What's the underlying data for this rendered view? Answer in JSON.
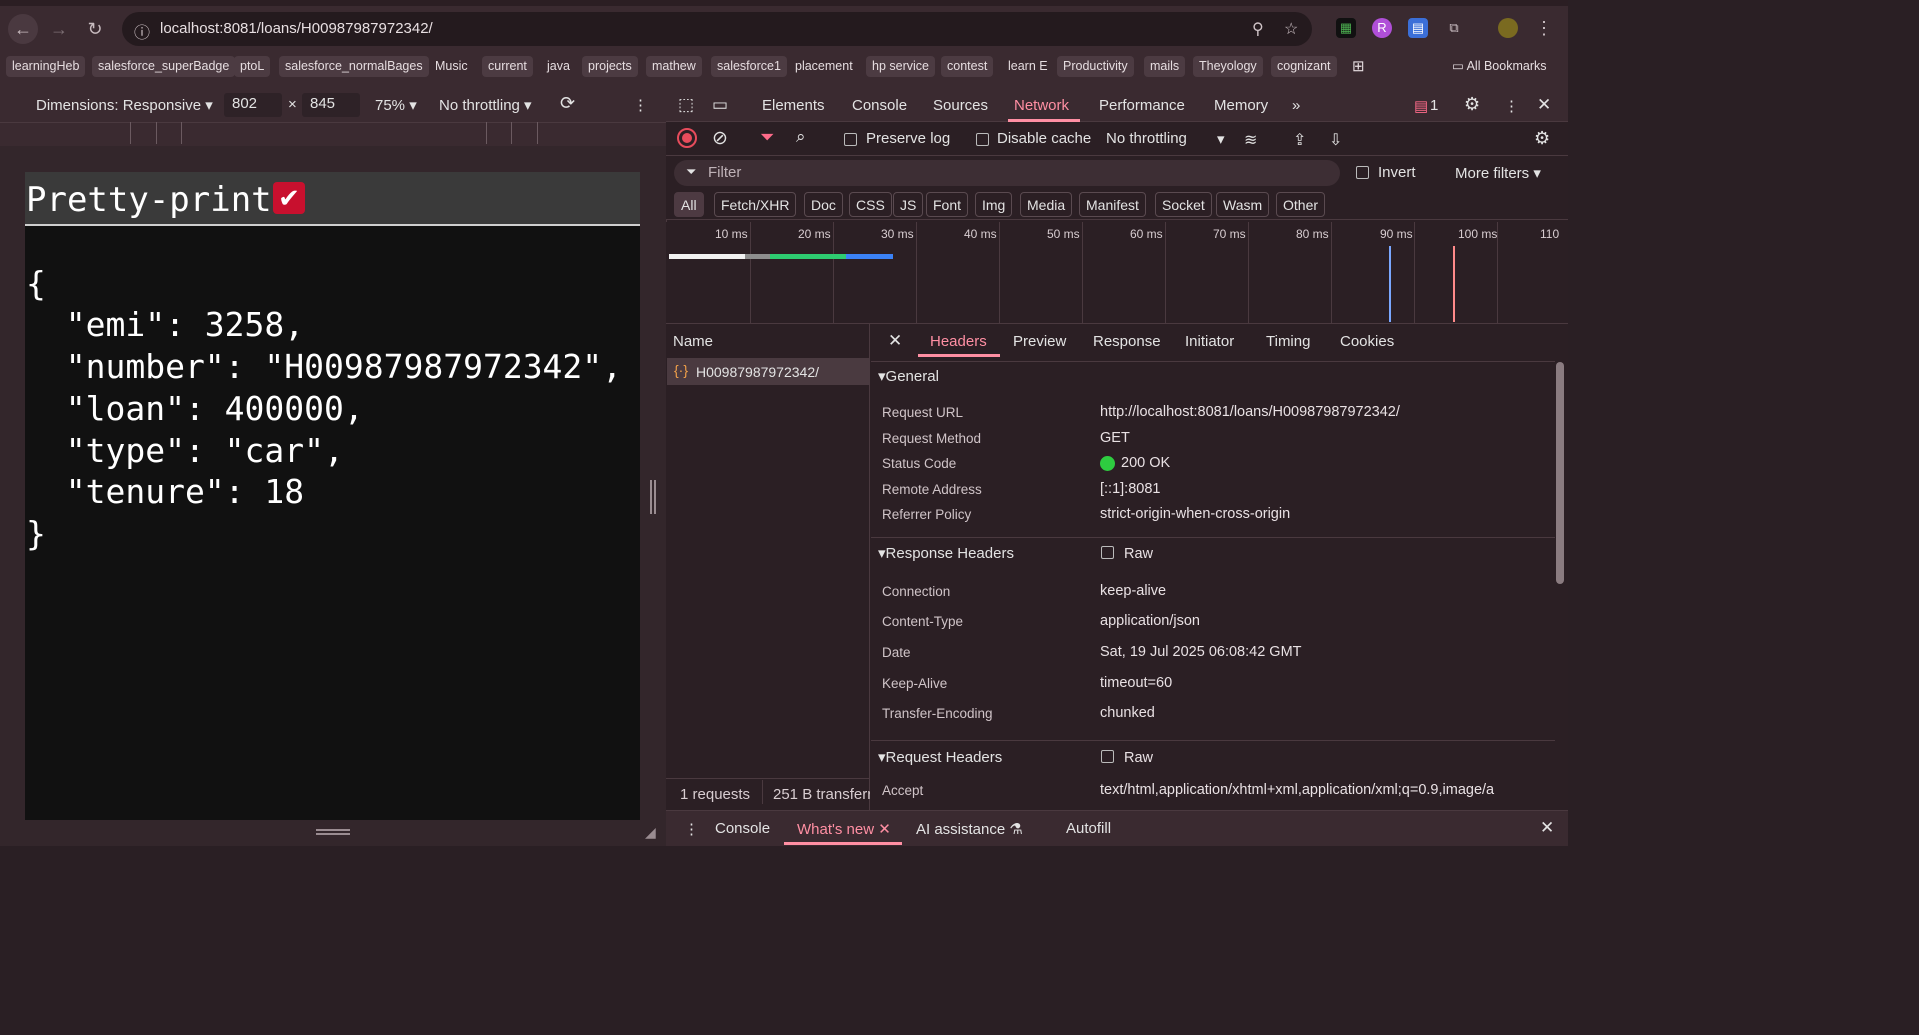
{
  "browser": {
    "url": "localhost:8081/loans/H00987987972342/",
    "bookmarks": [
      "learningHeb",
      "salesforce_superBadge",
      "ptoL",
      "salesforce_normalBages",
      "Music",
      "current",
      "java",
      "projects",
      "mathew",
      "salesforce1",
      "placement",
      "hp service",
      "contest",
      "learn E",
      "Productivity",
      "mails",
      "Theyology",
      "cognizant"
    ],
    "all_bookmarks": "All Bookmarks"
  },
  "device_toolbar": {
    "dimensions_label": "Dimensions: Responsive",
    "width": "802",
    "height": "845",
    "times": "×",
    "zoom": "75%",
    "throttling": "No throttling"
  },
  "page": {
    "pretty_print_label": "Pretty-print",
    "json_lines": [
      "{",
      "  \"emi\": 3258,",
      "  \"number\": \"H00987987972342\",",
      "  \"loan\": 400000,",
      "  \"type\": \"car\",",
      "  \"tenure\": 18",
      "}"
    ]
  },
  "devtools": {
    "tabs": [
      "Elements",
      "Console",
      "Sources",
      "Network",
      "Performance",
      "Memory"
    ],
    "issues_count": "1",
    "network_toolbar": {
      "preserve_log": "Preserve log",
      "disable_cache": "Disable cache",
      "throttling": "No throttling"
    },
    "filter_placeholder": "Filter",
    "invert": "Invert",
    "more_filters": "More filters",
    "type_filters": [
      "All",
      "Fetch/XHR",
      "Doc",
      "CSS",
      "JS",
      "Font",
      "Img",
      "Media",
      "Manifest",
      "Socket",
      "Wasm",
      "Other"
    ],
    "timeline_labels": [
      "10 ms",
      "20 ms",
      "30 ms",
      "40 ms",
      "50 ms",
      "60 ms",
      "70 ms",
      "80 ms",
      "90 ms",
      "100 ms",
      "110"
    ],
    "name_header": "Name",
    "request_name": "H00987987972342/",
    "status_requests": "1 requests",
    "status_transferred": "251 B transferr",
    "detail_tabs": [
      "Headers",
      "Preview",
      "Response",
      "Initiator",
      "Timing",
      "Cookies"
    ],
    "general": {
      "title": "General",
      "rows": [
        {
          "k": "Request URL",
          "v": "http://localhost:8081/loans/H00987987972342/"
        },
        {
          "k": "Request Method",
          "v": "GET"
        },
        {
          "k": "Status Code",
          "v": "200 OK"
        },
        {
          "k": "Remote Address",
          "v": "[::1]:8081"
        },
        {
          "k": "Referrer Policy",
          "v": "strict-origin-when-cross-origin"
        }
      ]
    },
    "response_headers": {
      "title": "Response Headers",
      "raw": "Raw",
      "rows": [
        {
          "k": "Connection",
          "v": "keep-alive"
        },
        {
          "k": "Content-Type",
          "v": "application/json"
        },
        {
          "k": "Date",
          "v": "Sat, 19 Jul 2025 06:08:42 GMT"
        },
        {
          "k": "Keep-Alive",
          "v": "timeout=60"
        },
        {
          "k": "Transfer-Encoding",
          "v": "chunked"
        }
      ]
    },
    "request_headers": {
      "title": "Request Headers",
      "raw": "Raw",
      "rows": [
        {
          "k": "Accept",
          "v": "text/html,application/xhtml+xml,application/xml;q=0.9,image/a"
        }
      ]
    },
    "drawer_tabs": [
      "Console",
      "What's new",
      "AI assistance",
      "Autofill"
    ]
  },
  "colors": {
    "accent": "#ff8fa3",
    "status_ok": "#2ecc40",
    "pretty_check": "#c8102e"
  }
}
